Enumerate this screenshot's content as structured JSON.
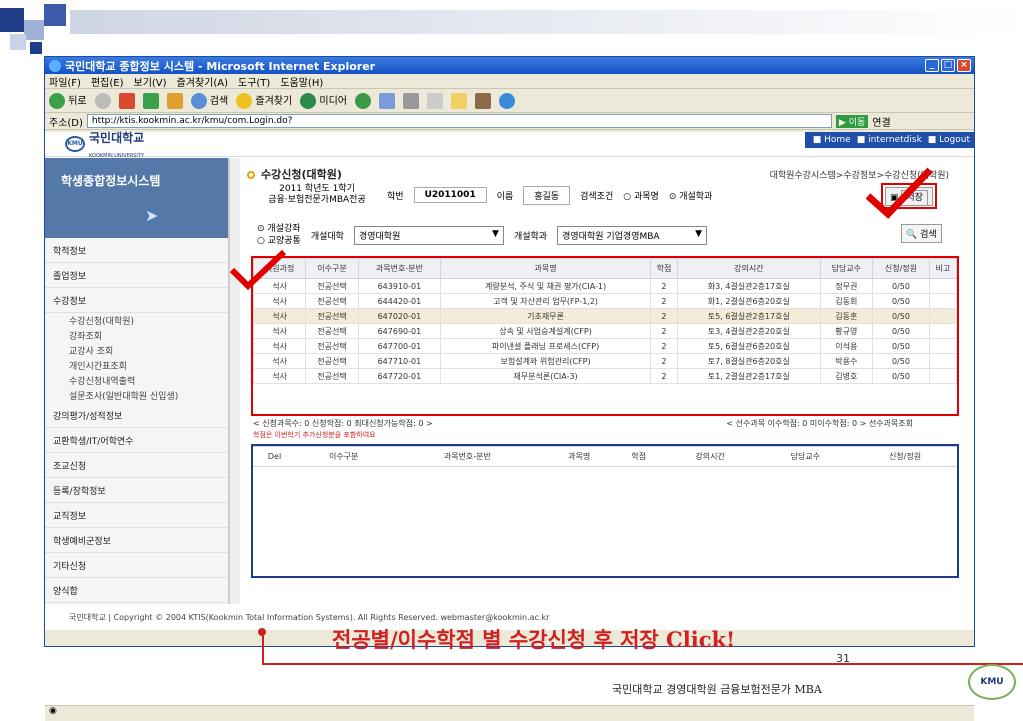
{
  "window": {
    "title": "국민대학교 종합정보 시스템 - Microsoft Internet Explorer",
    "menu": [
      "파일(F)",
      "편집(E)",
      "보기(V)",
      "즐겨찾기(A)",
      "도구(T)",
      "도움말(H)"
    ],
    "toolbar": [
      "뒤로",
      "검색",
      "즐겨찾기",
      "미디어"
    ],
    "address_label": "주소(D)",
    "address": "http://ktis.kookmin.ac.kr/kmu/com.Login.do?",
    "go_label": "이동",
    "links_label": "연결",
    "status_text": ""
  },
  "site": {
    "logo_text": "국민대학교",
    "logo_sub": "KOOKMIN UNIVERSITY",
    "header_links": [
      "Home",
      "internetdisk",
      "Logout"
    ],
    "sidebar_title": "학생종합정보시스템",
    "sidebar_items": [
      {
        "label": "학적정보",
        "subs": []
      },
      {
        "label": "졸업정보",
        "subs": []
      },
      {
        "label": "수강정보",
        "subs": [
          "수강신청(대학원)",
          "강좌조회",
          "교강사 조회",
          "개인시간표조회",
          "수강신청내역출력",
          "설문조사(일반대학원 신입생)"
        ]
      },
      {
        "label": "강의평가/성적정보",
        "subs": []
      },
      {
        "label": "교환학생/IT/어학연수",
        "subs": []
      },
      {
        "label": "조교신청",
        "subs": []
      },
      {
        "label": "등록/장학정보",
        "subs": []
      },
      {
        "label": "교직정보",
        "subs": []
      },
      {
        "label": "학생예비군정보",
        "subs": []
      },
      {
        "label": "기타신청",
        "subs": []
      },
      {
        "label": "양식합",
        "subs": []
      }
    ],
    "footer": "국민대학교 | Copyright © 2004 KTIS(Kookmin Total Information Systems). All Rights Reserved. webmaster@kookmin.ac.kr"
  },
  "main": {
    "title": "수강신청(대학원)",
    "breadcrumb": "대학원수강시스템>수강정보>수강신청(대학원)",
    "program_line1": "2011 학년도 1학기",
    "program_line2": "금융·보험전문가MBA전공",
    "student_id_label": "학번",
    "student_id": "U2011001",
    "name_label": "이름",
    "name": "홍길동",
    "search_cond_label": "검색조건",
    "radio_course": "과목명",
    "radio_dept": "개설학과",
    "save_label": "저장",
    "radio_open": "개설강좌",
    "radio_general": "교양공통",
    "college_label": "개설대학",
    "college_value": "경영대학원",
    "dept_label": "개설학과",
    "dept_value": "경영대학원 기업경영MBA",
    "search_label": "검색"
  },
  "course_table": {
    "headers": [
      "지원과정",
      "이수구분",
      "과목번호-분반",
      "과목명",
      "학점",
      "강의시간",
      "담당교수",
      "신청/정원",
      "비고"
    ],
    "rows": [
      [
        "석사",
        "전공선택",
        "643910-01",
        "계량분석, 주식 및 채권 평가(CIA-1)",
        "2",
        "화3, 4결실관2층17호실",
        "정무권",
        "0/50",
        ""
      ],
      [
        "석사",
        "전공선택",
        "644420-01",
        "고객 및 자산관리 업무(FP-1,2)",
        "2",
        "화1, 2결실관6층20호실",
        "김동회",
        "0/50",
        ""
      ],
      [
        "석사",
        "전공선택",
        "647020-01",
        "기초재무론",
        "2",
        "토5, 6결실관2층17호실",
        "김동훈",
        "0/50",
        ""
      ],
      [
        "석사",
        "전공선택",
        "647690-01",
        "상속 및 사업승계설계(CFP)",
        "2",
        "토3, 4결실관2층20호실",
        "황규영",
        "0/50",
        ""
      ],
      [
        "석사",
        "전공선택",
        "647700-01",
        "파이낸셜 플래닝 프로세스(CFP)",
        "2",
        "토5, 6결실관6층20호실",
        "이석용",
        "0/50",
        ""
      ],
      [
        "석사",
        "전공선택",
        "647710-01",
        "보험설계와 위험관리(CFP)",
        "2",
        "토7, 8결실관6층20호실",
        "박용수",
        "0/50",
        ""
      ],
      [
        "석사",
        "전공선택",
        "647720-01",
        "재무분석론(CIA-3)",
        "2",
        "토1, 2결실관2층17호실",
        "김병호",
        "0/50",
        ""
      ]
    ],
    "pager_left": "< 신청과목수: 0   신청학점: 0   최대신청가능학점: 0   >",
    "pager_right": "< 선수과목 이수학점: 0   미이수학점: 0  >  선수과목조회",
    "note": "학점은 이번학기 추가신청분을 포함하여요"
  },
  "selected_table": {
    "headers": [
      "Del",
      "이수구분",
      "과목번호-분반",
      "과목명",
      "학점",
      "강의시간",
      "담당교수",
      "신청/정원"
    ]
  },
  "slide": {
    "caption": "전공별/이수학점 별 수강신청 후 저장 Click!",
    "page_number": "31",
    "bottom_text": "국민대학교 경영대학원 금융보험전문가 MBA",
    "logo_text": "KMU"
  }
}
